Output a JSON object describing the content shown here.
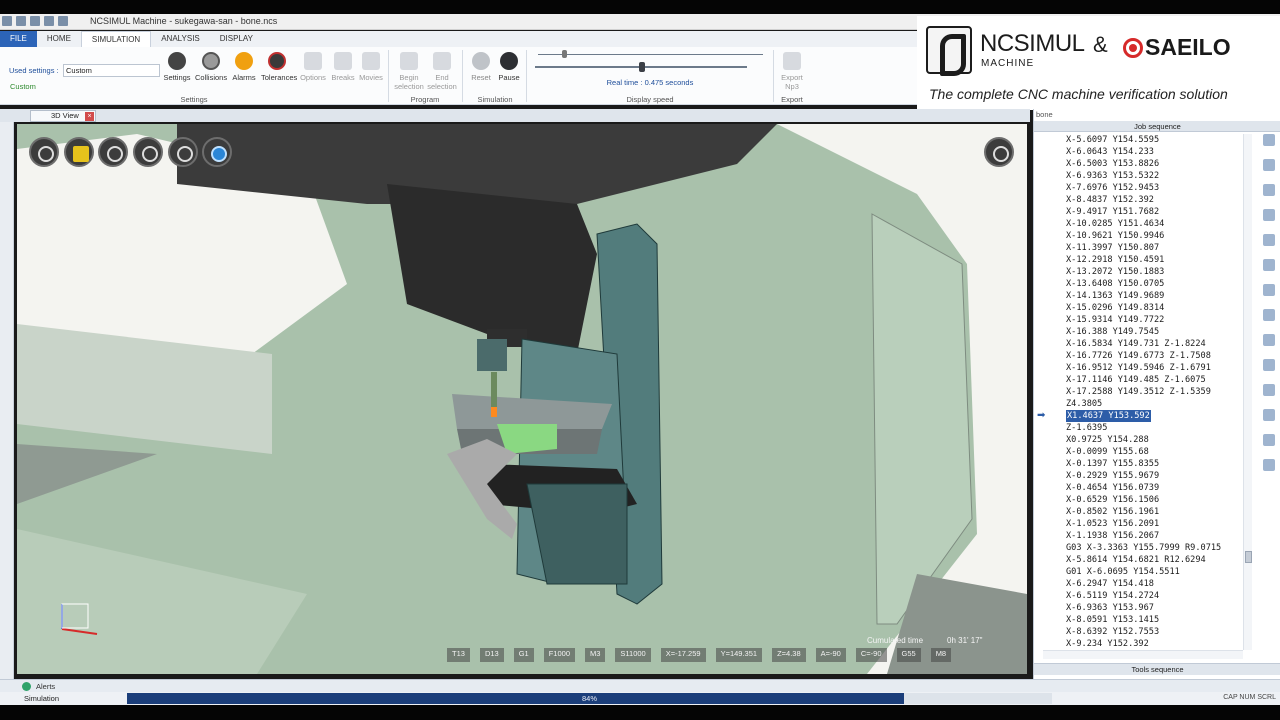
{
  "window": {
    "title": "NCSIMUL Machine - sukegawa-san - bone.ncs"
  },
  "tabs": [
    "FILE",
    "HOME",
    "SIMULATION",
    "ANALYSIS",
    "DISPLAY"
  ],
  "ribbon": {
    "used_settings_label": "Used settings :",
    "used_settings_value": "Custom",
    "custom_label": "Custom",
    "buttons": [
      {
        "label": "Settings",
        "icon": "gear-icon",
        "color": "#444444"
      },
      {
        "label": "Collisions",
        "icon": "collisions-icon",
        "color": "#9a9a9a"
      },
      {
        "label": "Alarms",
        "icon": "alarm-icon",
        "color": "#f0a010"
      },
      {
        "label": "Tolerances",
        "icon": "tolerance-icon",
        "color": "#3a3a3a"
      },
      {
        "label": "Options",
        "icon": "options-icon",
        "color": "#cccccc"
      },
      {
        "label": "Breaks",
        "icon": "breaks-icon",
        "color": "#cccccc"
      },
      {
        "label": "Movies",
        "icon": "movies-icon",
        "color": "#cccccc"
      }
    ],
    "program_buttons": [
      {
        "label": "Begin selection"
      },
      {
        "label": "End selection"
      }
    ],
    "sim_buttons": [
      {
        "label": "Reset"
      },
      {
        "label": "Pause"
      }
    ],
    "export_button": {
      "label": "Export Np3"
    },
    "groups": {
      "settings": "Settings",
      "program": "Program",
      "simulation": "Simulation",
      "display_speed": "Display speed",
      "export": "Export"
    },
    "realtime": "Real time : 0.475 seconds"
  },
  "brand": {
    "ncsimul": "NCSIMUL",
    "amp": "&",
    "machine": "MACHINE",
    "saeilo": "SAEILO",
    "tagline": "The complete CNC machine verification solution"
  },
  "view": {
    "tab_label": "3D View",
    "status": [
      "T13",
      "D13",
      "G1",
      "F1000",
      "M3",
      "S11000",
      "X=-17.259",
      "Y=149.351",
      "Z=4.38",
      "A=-90",
      "C=-90",
      "G55",
      "M8"
    ],
    "cumulated_label": "Cumulated time",
    "cumulated_value": "0h 31' 17\""
  },
  "panel": {
    "name": "bone",
    "header": "Job sequence",
    "footer": "Tools sequence",
    "lines": [
      "X-5.6097 Y154.5595",
      "X-6.0643 Y154.233",
      "X-6.5003 Y153.8826",
      "X-6.9363 Y153.5322",
      "X-7.6976 Y152.9453",
      "X-8.4837 Y152.392",
      "X-9.4917 Y151.7682",
      "X-10.0285 Y151.4634",
      "X-10.9621 Y150.9946",
      "X-11.3997 Y150.807",
      "X-12.2918 Y150.4591",
      "X-13.2072 Y150.1883",
      "X-13.6408 Y150.0705",
      "X-14.1363 Y149.9689",
      "X-15.0296 Y149.8314",
      "X-15.9314 Y149.7722",
      "X-16.388 Y149.7545",
      "X-16.5834 Y149.731 Z-1.8224",
      "X-16.7726 Y149.6773 Z-1.7508",
      "X-16.9512 Y149.5946 Z-1.6791",
      "X-17.1146 Y149.485 Z-1.6075",
      "X-17.2588 Y149.3512 Z-1.5359",
      "Z4.3805",
      "X1.4637 Y153.592",
      "Z-1.6395",
      "X0.9725 Y154.288",
      "X-0.0099 Y155.68",
      "X-0.1397 Y155.8355",
      "X-0.2929 Y155.9679",
      "X-0.4654 Y156.0739",
      "X-0.6529 Y156.1506",
      "X-0.8502 Y156.1961",
      "X-1.0523 Y156.2091",
      "X-1.1938 Y156.2067",
      "G03 X-3.3363 Y155.7999 R9.0715",
      "X-5.8614 Y154.6821 R12.6294",
      "G01 X-6.0695 Y154.5511",
      "X-6.2947 Y154.418",
      "X-6.5119 Y154.2724",
      "X-6.9363 Y153.967",
      "X-8.0591 Y153.1415",
      "X-8.6392 Y152.7553",
      "X-9.234 Y152.392"
    ],
    "selected_index": 23
  },
  "bottom": {
    "alerts_label": "Alerts",
    "status_label": "Simulation",
    "progress": 0.84,
    "progress_text": "84%",
    "caps": "CAP  NUM  SCRL"
  }
}
